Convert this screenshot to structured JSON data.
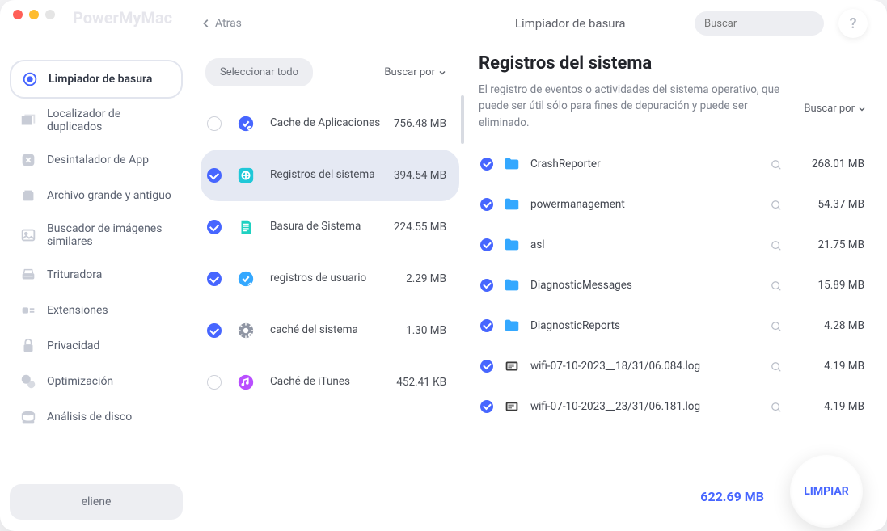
{
  "brand": "PowerMyMac",
  "back_label": "Atras",
  "top_title": "Limpiador de basura",
  "search": {
    "placeholder": "Buscar"
  },
  "help_label": "?",
  "user": "eliene",
  "sidebar": {
    "items": [
      {
        "label": "Limpiador de basura"
      },
      {
        "label": "Localizador de duplicados"
      },
      {
        "label": "Desintalador de App"
      },
      {
        "label": "Archivo grande y antiguo"
      },
      {
        "label": "Buscador de imágenes similares"
      },
      {
        "label": "Trituradora"
      },
      {
        "label": "Extensiones"
      },
      {
        "label": "Privacidad"
      },
      {
        "label": "Optimización"
      },
      {
        "label": "Análisis de disco"
      }
    ]
  },
  "mid": {
    "select_all": "Seleccionar todo",
    "sort_by": "Buscar por",
    "items": [
      {
        "name": "Cache de Aplicaciones",
        "size": "756.48 MB",
        "checked": false,
        "color": "#4766ff"
      },
      {
        "name": "Registros del sistema",
        "size": "394.54 MB",
        "checked": true,
        "color": "#20c8d8",
        "selected": true
      },
      {
        "name": "Basura de Sistema",
        "size": "224.55 MB",
        "checked": true,
        "color": "#1fd1c1"
      },
      {
        "name": "registros de usuario",
        "size": "2.29 MB",
        "checked": true,
        "color": "#34a8ff"
      },
      {
        "name": "caché del sistema",
        "size": "1.30 MB",
        "checked": true,
        "color": "#8f95a3"
      },
      {
        "name": "Caché de iTunes",
        "size": "452.41 KB",
        "checked": false,
        "color": "#b94fff"
      }
    ]
  },
  "right": {
    "title": "Registros del sistema",
    "desc": "El registro de eventos o actividades del sistema operativo, que puede ser útil sólo para fines de depuración y puede ser eliminado.",
    "sort_by": "Buscar por",
    "files": [
      {
        "name": "CrashReporter",
        "size": "268.01 MB",
        "icon": "folder"
      },
      {
        "name": "powermanagement",
        "size": "54.37 MB",
        "icon": "folder"
      },
      {
        "name": "asl",
        "size": "21.75 MB",
        "icon": "folder"
      },
      {
        "name": "DiagnosticMessages",
        "size": "15.89 MB",
        "icon": "folder"
      },
      {
        "name": "DiagnosticReports",
        "size": "4.28 MB",
        "icon": "folder"
      },
      {
        "name": "wifi-07-10-2023__18/31/06.084.log",
        "size": "4.19 MB",
        "icon": "text"
      },
      {
        "name": "wifi-07-10-2023__23/31/06.181.log",
        "size": "4.19 MB",
        "icon": "text"
      }
    ]
  },
  "footer": {
    "total": "622.69 MB",
    "clean": "LIMPIAR"
  }
}
